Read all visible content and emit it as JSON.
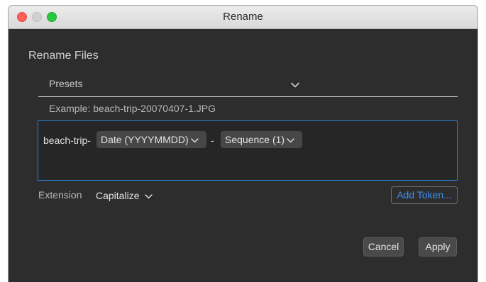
{
  "window": {
    "title": "Rename"
  },
  "dialog": {
    "heading": "Rename Files",
    "presets": {
      "label": "Presets",
      "icon": "chevron-down-icon"
    },
    "example": "Example: beach-trip-20070407-1.JPG",
    "token_area": {
      "fixed_text": "beach-trip-",
      "tokens": [
        {
          "label": "Date (YYYYMMDD)",
          "icon": "chevron-down-icon"
        },
        {
          "label": "Sequence (1)",
          "icon": "chevron-down-icon"
        }
      ],
      "separator": "-",
      "accent_color": "#2f7ed8"
    },
    "extension": {
      "label": "Extension",
      "value": "Capitalize",
      "icon": "chevron-down-icon"
    },
    "add_token_label": "Add Token...",
    "buttons": {
      "cancel": "Cancel",
      "apply": "Apply"
    }
  },
  "colors": {
    "window_bg": "#2d2d2d",
    "close": "#fe5f57",
    "minimize": "#d0d0d0",
    "maximize": "#28c840",
    "link_blue": "#3c8ff2"
  }
}
